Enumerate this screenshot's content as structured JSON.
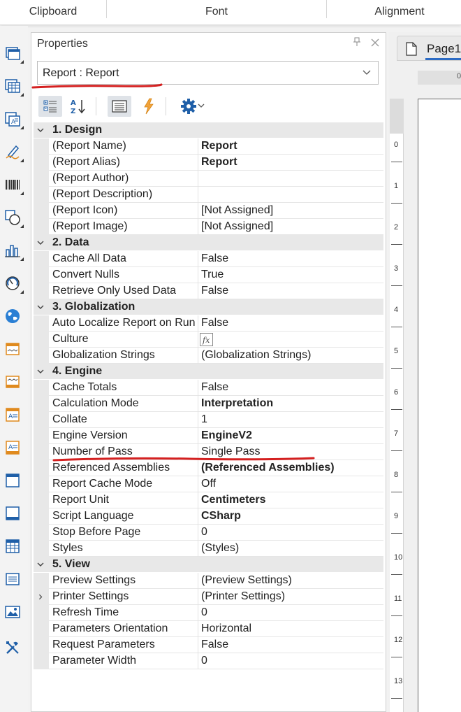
{
  "ribbon": {
    "groups": [
      "Clipboard",
      "Font",
      "Alignment"
    ]
  },
  "toolbox": {
    "icons": [
      "band-icon",
      "table-icon",
      "text-component-icon",
      "drawing-pen-icon",
      "barcode-icon",
      "shapes-icon",
      "chart-icon",
      "gauge-icon",
      "map-globe-icon",
      "page-header-band-icon",
      "page-footer-band-icon",
      "report-title-band-icon",
      "report-summary-band-icon",
      "header-band-icon",
      "footer-band-icon",
      "data-band-icon",
      "text-list-icon",
      "image-icon",
      "tools-icon"
    ]
  },
  "properties": {
    "title": "Properties",
    "selected_object": "Report : Report",
    "toolbar": [
      "categorized-icon",
      "sort-alphabetical-icon",
      "property-list-icon",
      "events-lightning-icon",
      "settings-gear-icon"
    ],
    "categories": [
      {
        "label": "1. Design",
        "rows": [
          {
            "name": "(Report Name)",
            "value": "Report",
            "bold": true
          },
          {
            "name": "(Report Alias)",
            "value": "Report",
            "bold": true
          },
          {
            "name": "(Report Author)",
            "value": ""
          },
          {
            "name": "(Report Description)",
            "value": ""
          },
          {
            "name": "(Report Icon)",
            "value": "[Not Assigned]"
          },
          {
            "name": "(Report Image)",
            "value": "[Not Assigned]"
          }
        ]
      },
      {
        "label": "2. Data",
        "rows": [
          {
            "name": "Cache All Data",
            "value": "False"
          },
          {
            "name": "Convert Nulls",
            "value": "True"
          },
          {
            "name": "Retrieve Only Used Data",
            "value": "False"
          }
        ]
      },
      {
        "label": "3. Globalization",
        "rows": [
          {
            "name": "Auto Localize Report on Run",
            "value": "False"
          },
          {
            "name": "Culture",
            "value": "",
            "fx": true
          },
          {
            "name": "Globalization Strings",
            "value": "(Globalization Strings)"
          }
        ]
      },
      {
        "label": "4. Engine",
        "rows": [
          {
            "name": "Cache Totals",
            "value": "False"
          },
          {
            "name": "Calculation Mode",
            "value": "Interpretation",
            "bold": true
          },
          {
            "name": "Collate",
            "value": "1"
          },
          {
            "name": "Engine Version",
            "value": "EngineV2",
            "bold": true
          },
          {
            "name": "Number of Pass",
            "value": "Single Pass"
          },
          {
            "name": "Referenced Assemblies",
            "value": "(Referenced Assemblies)",
            "bold": true
          },
          {
            "name": "Report Cache Mode",
            "value": "Off"
          },
          {
            "name": "Report Unit",
            "value": "Centimeters",
            "bold": true
          },
          {
            "name": "Script Language",
            "value": "CSharp",
            "bold": true
          },
          {
            "name": "Stop Before Page",
            "value": "0"
          },
          {
            "name": "Styles",
            "value": "(Styles)"
          }
        ]
      },
      {
        "label": "5. View",
        "rows": [
          {
            "name": "Preview Settings",
            "value": "(Preview Settings)"
          },
          {
            "name": "Printer Settings",
            "value": "(Printer Settings)",
            "expandable": true
          },
          {
            "name": "Refresh Time",
            "value": "0"
          },
          {
            "name": "Parameters Orientation",
            "value": "Horizontal"
          },
          {
            "name": "Request Parameters",
            "value": "False"
          },
          {
            "name": "Parameter Width",
            "value": "0"
          }
        ]
      }
    ]
  },
  "designer": {
    "page_tab": "Page1",
    "hruler_start": "0",
    "vruler_numbers": [
      "0",
      "1",
      "2",
      "3",
      "4",
      "5",
      "6",
      "7",
      "8",
      "9",
      "10",
      "11",
      "12",
      "13"
    ]
  },
  "annotation_color": "#d42020"
}
